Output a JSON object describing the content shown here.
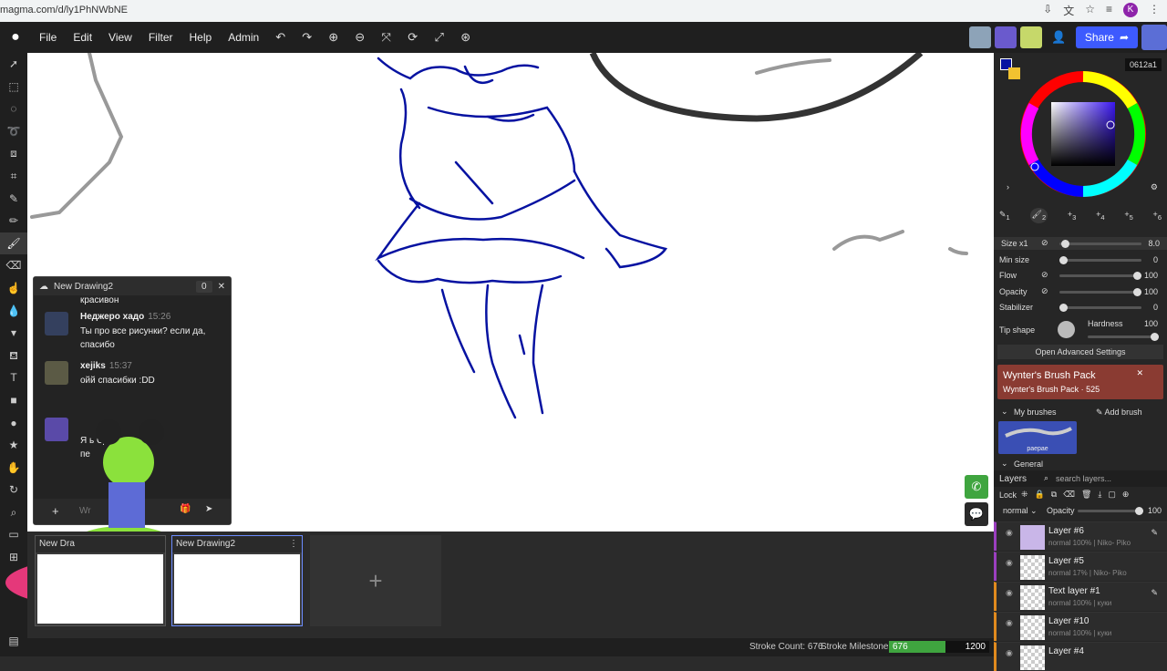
{
  "browser": {
    "url": "magma.com/d/ly1PhNWbNE",
    "profile_letter": "K"
  },
  "menu": {
    "items": [
      "File",
      "Edit",
      "View",
      "Filter",
      "Help",
      "Admin"
    ],
    "share_label": "Share"
  },
  "chat": {
    "title": "New Drawing2",
    "count": "0",
    "partial_top": "красивон",
    "messages": [
      {
        "name": "Неджеро хадо",
        "time": "15:26",
        "text": "Ты про все рисунки? если да, спасибо"
      },
      {
        "name": "xejiks",
        "time": "15:37",
        "text": "ойй спасибки :DD"
      },
      {
        "name": "",
        "time": "",
        "text": "Я ь СД я пе"
      }
    ],
    "input_placeholder": "Wr"
  },
  "thumbs": [
    {
      "title": "New Dra"
    },
    {
      "title": "New Drawing2"
    }
  ],
  "status": {
    "stroke_count_label": "Stroke Count: 676",
    "milestone_label": "Stroke Milestone:",
    "milestone_value": "676",
    "milestone_target": "1200",
    "milestone_fraction": 0.563
  },
  "color": {
    "hex": "0612a1",
    "primary": "#0612a1"
  },
  "brush": {
    "slots": [
      "1",
      "2",
      "3",
      "4",
      "5",
      "6"
    ],
    "size_label": "Size x1",
    "size_value": "8.0",
    "min_size_label": "Min size",
    "min_size_value": "0",
    "flow_label": "Flow",
    "flow_value": "100",
    "opacity_label": "Opacity",
    "opacity_value": "100",
    "stabilizer_label": "Stabilizer",
    "stabilizer_value": "0",
    "tip_shape_label": "Tip shape",
    "hardness_label": "Hardness",
    "hardness_value": "100",
    "advanced_label": "Open Advanced Settings"
  },
  "pack": {
    "title": "Wynter's Brush Pack",
    "subtitle": "Wynter's Brush Pack · 525"
  },
  "my_brushes": {
    "label": "My brushes",
    "add_label": "Add brush",
    "brush_name": "paepae",
    "general_label": "General"
  },
  "layers": {
    "title": "Layers",
    "search_placeholder": "search layers...",
    "lock_label": "Lock",
    "blend_mode": "normal",
    "opacity_label": "Opacity",
    "opacity_value": "100",
    "items": [
      {
        "name": "Layer #6",
        "meta": "normal 100% | Niko- Piko"
      },
      {
        "name": "Layer #5",
        "meta": "normal 17% | Niko- Piko"
      },
      {
        "name": "Text layer #1",
        "meta": "normal 100% | куки"
      },
      {
        "name": "Layer #10",
        "meta": "normal 100% | куки"
      },
      {
        "name": "Layer #4",
        "meta": ""
      }
    ]
  }
}
